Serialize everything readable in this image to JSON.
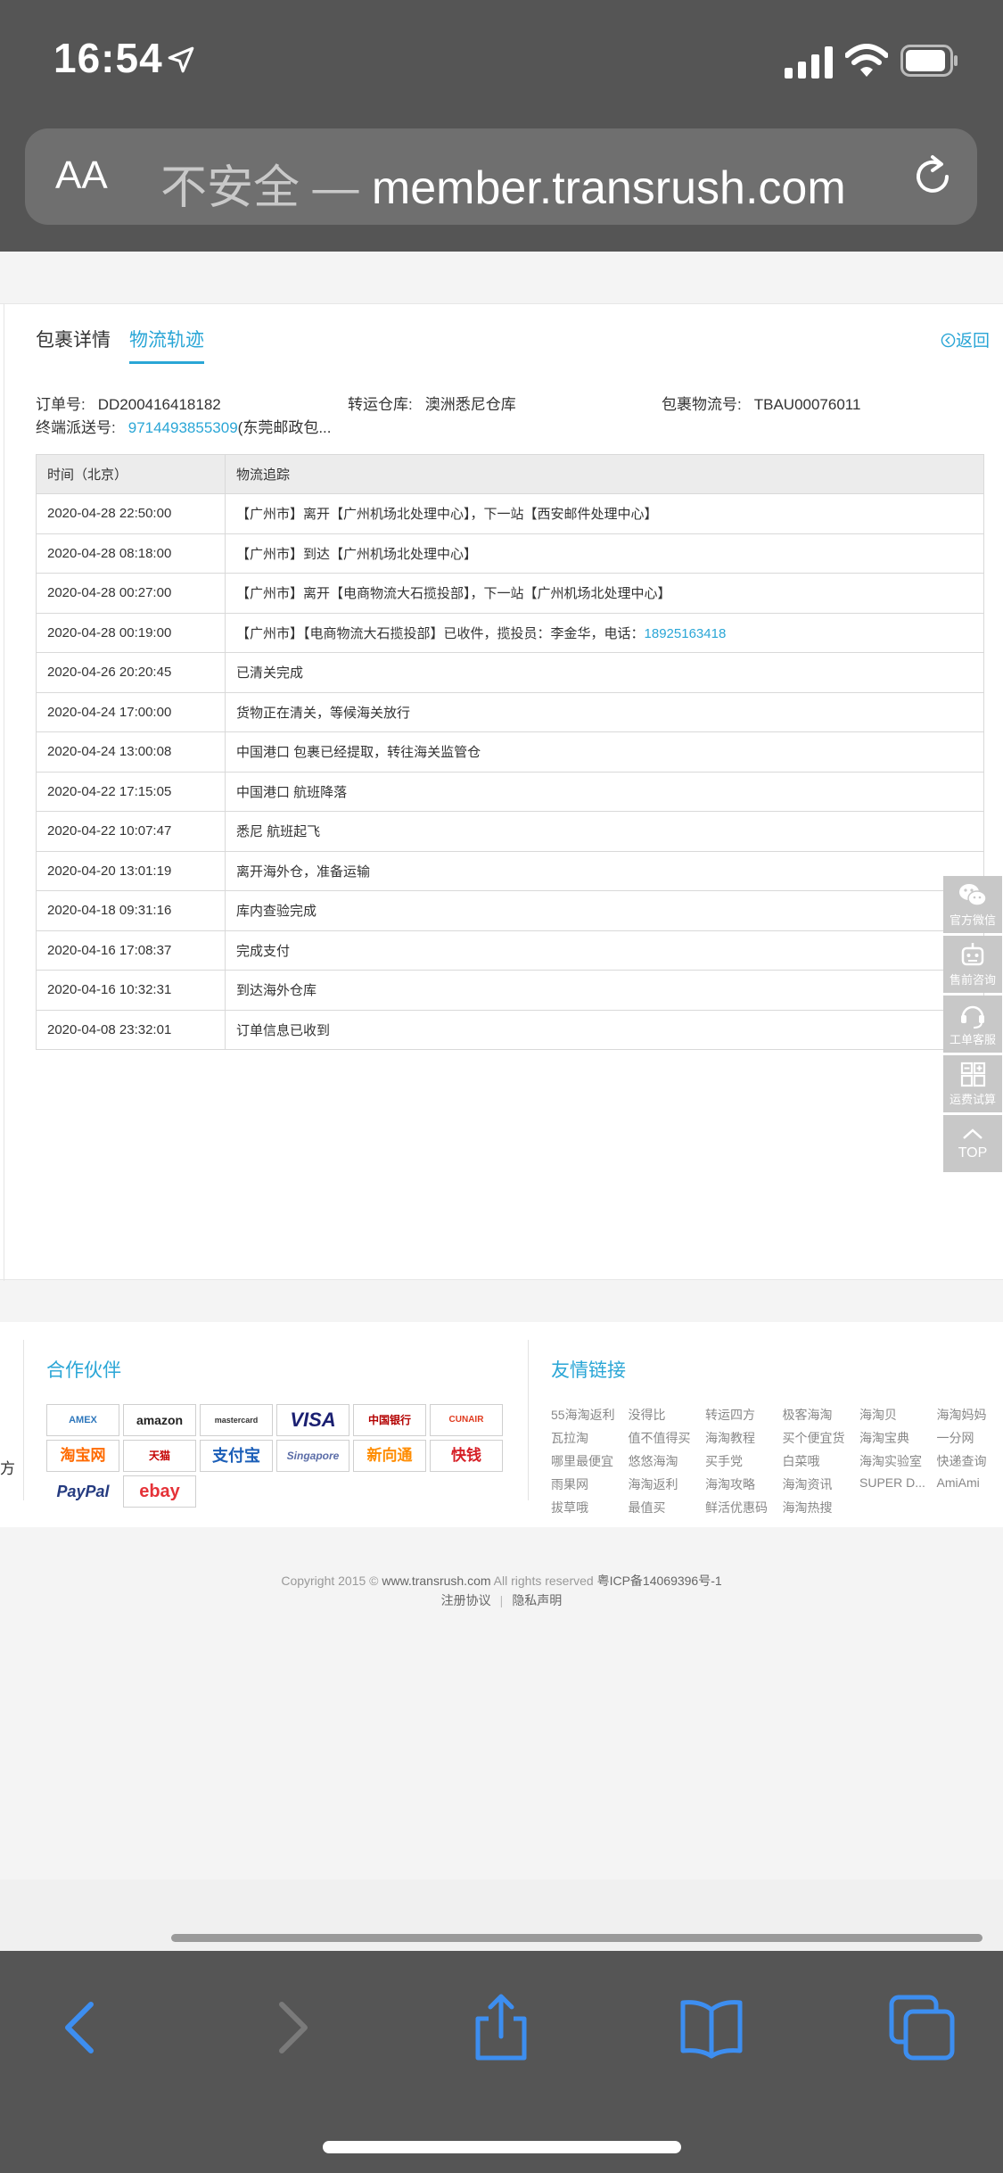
{
  "status_bar": {
    "time": "16:54"
  },
  "browser": {
    "aa_label": "AA",
    "url_insecure": "不安全 — ",
    "url_domain": "member.transrush.com"
  },
  "tabs": {
    "detail": "包裹详情",
    "track": "物流轨迹",
    "back": "返回"
  },
  "order_info": {
    "order_no_label": "订单号:",
    "order_no": "DD200416418182",
    "warehouse_label": "转运仓库:",
    "warehouse": "澳洲悉尼仓库",
    "logistics_no_label": "包裹物流号:",
    "logistics_no": "TBAU00076011",
    "final_label": "终端派送号:",
    "final_no": "9714493855309",
    "final_note": "(东莞邮政包..."
  },
  "table": {
    "headers": [
      "时间（北京）",
      "物流追踪"
    ],
    "rows": [
      {
        "time": "2020-04-28 22:50:00",
        "text": "【广州市】离开【广州机场北处理中心】，下一站【西安邮件处理中心】",
        "tel": ""
      },
      {
        "time": "2020-04-28 08:18:00",
        "text": "【广州市】到达【广州机场北处理中心】",
        "tel": ""
      },
      {
        "time": "2020-04-28 00:27:00",
        "text": "【广州市】离开【电商物流大石揽投部】，下一站【广州机场北处理中心】",
        "tel": ""
      },
      {
        "time": "2020-04-28 00:19:00",
        "text": "【广州市】【电商物流大石揽投部】已收件，揽投员：李金华，电话：",
        "tel": "18925163418"
      },
      {
        "time": "2020-04-26 20:20:45",
        "text": "已清关完成",
        "tel": ""
      },
      {
        "time": "2020-04-24 17:00:00",
        "text": "货物正在清关，等候海关放行",
        "tel": ""
      },
      {
        "time": "2020-04-24 13:00:08",
        "text": "中国港口 包裹已经提取，转往海关监管仓",
        "tel": ""
      },
      {
        "time": "2020-04-22 17:15:05",
        "text": "中国港口 航班降落",
        "tel": ""
      },
      {
        "time": "2020-04-22 10:07:47",
        "text": "悉尼 航班起飞",
        "tel": ""
      },
      {
        "time": "2020-04-20 13:01:19",
        "text": "离开海外仓，准备运输",
        "tel": ""
      },
      {
        "time": "2020-04-18 09:31:16",
        "text": "库内查验完成",
        "tel": ""
      },
      {
        "time": "2020-04-16 17:08:37",
        "text": "完成支付",
        "tel": ""
      },
      {
        "time": "2020-04-16 10:32:31",
        "text": "到达海外仓库",
        "tel": ""
      },
      {
        "time": "2020-04-08 23:32:01",
        "text": "订单信息已收到",
        "tel": ""
      }
    ]
  },
  "side_widgets": [
    "官方微信",
    "售前咨询",
    "工单客服",
    "运费试算",
    "TOP"
  ],
  "footer": {
    "cut_text": "方",
    "partners_title": "合作伙伴",
    "links_title": "友情链接",
    "partners": [
      "AMEX",
      "amazon",
      "mastercard",
      "VISA",
      "中国银行",
      "CUNAIR",
      "淘宝网",
      "天猫",
      "支付宝",
      "Singapore",
      "新向通",
      "快钱",
      "PayPal",
      "ebay"
    ],
    "links": [
      "55海淘返利",
      "没得比",
      "转运四方",
      "极客海淘",
      "海淘贝",
      "海淘妈妈",
      "瓦拉淘",
      "值不值得买",
      "海淘教程",
      "买个便宜货",
      "海淘宝典",
      "一分网",
      "哪里最便宜",
      "悠悠海淘",
      "买手党",
      "白菜哦",
      "海淘实验室",
      "快递查询",
      "雨果网",
      "海淘返利",
      "海淘攻略",
      "海淘资讯",
      "SUPER D...",
      "AmiAmi",
      "拔草哦",
      "最值买",
      "鲜活优惠码",
      "海淘热搜"
    ],
    "copyright_pre": "Copyright 2015 © ",
    "copyright_site": "www.transrush.com",
    "copyright_mid": " All rights reserved ",
    "copyright_icp": "粤ICP备14069396号-1",
    "register": "注册协议",
    "privacy": "隐私声明",
    "sep": "|"
  }
}
